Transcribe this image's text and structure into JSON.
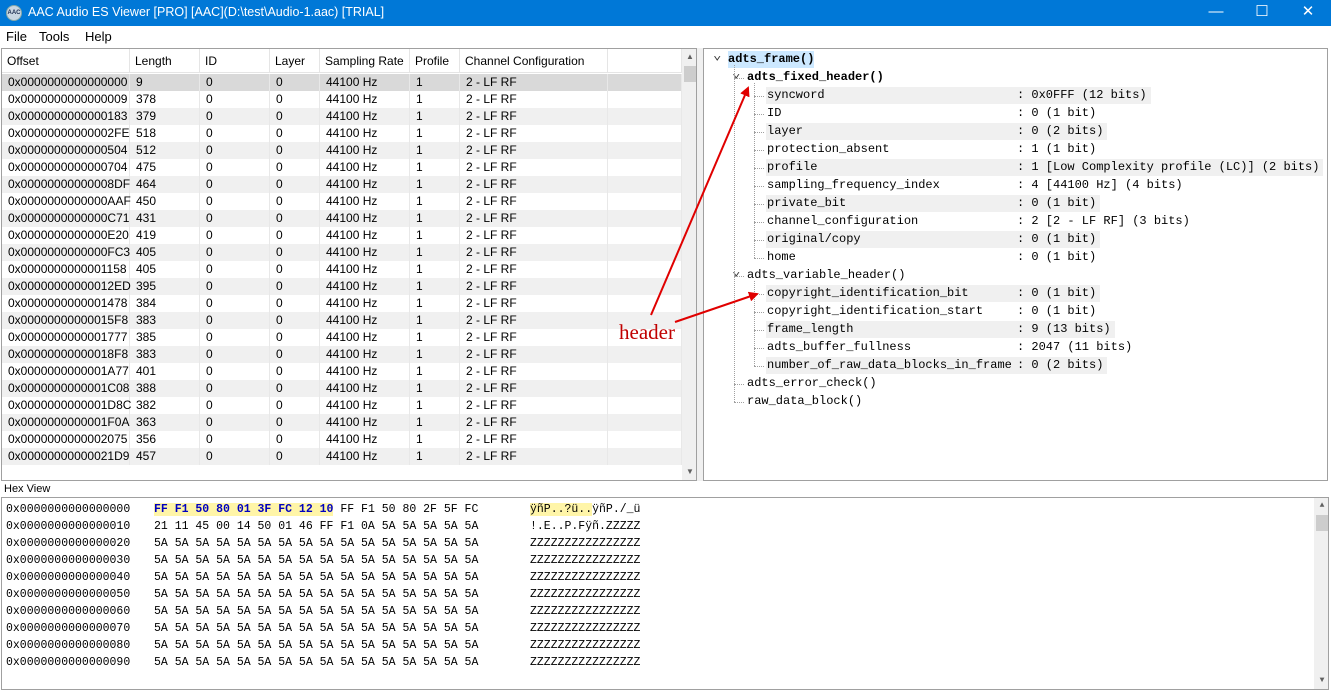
{
  "window": {
    "title": "AAC Audio ES Viewer [PRO] [AAC](D:\\test\\Audio-1.aac) [TRIAL]",
    "icon_text": "AAC",
    "minimize_glyph": "—",
    "maximize_glyph": "☐",
    "close_glyph": "✕"
  },
  "menu": {
    "file": "File",
    "tools": "Tools",
    "help": "Help"
  },
  "frame_list": {
    "columns": [
      "Offset",
      "Length",
      "ID",
      "Layer",
      "Sampling Rate",
      "Profile",
      "Channel Configuration"
    ],
    "rows": [
      [
        "0x0000000000000000",
        "9",
        "0",
        "0",
        "44100 Hz",
        "1",
        "2 - LF RF"
      ],
      [
        "0x0000000000000009",
        "378",
        "0",
        "0",
        "44100 Hz",
        "1",
        "2 - LF RF"
      ],
      [
        "0x0000000000000183",
        "379",
        "0",
        "0",
        "44100 Hz",
        "1",
        "2 - LF RF"
      ],
      [
        "0x00000000000002FE",
        "518",
        "0",
        "0",
        "44100 Hz",
        "1",
        "2 - LF RF"
      ],
      [
        "0x0000000000000504",
        "512",
        "0",
        "0",
        "44100 Hz",
        "1",
        "2 - LF RF"
      ],
      [
        "0x0000000000000704",
        "475",
        "0",
        "0",
        "44100 Hz",
        "1",
        "2 - LF RF"
      ],
      [
        "0x00000000000008DF",
        "464",
        "0",
        "0",
        "44100 Hz",
        "1",
        "2 - LF RF"
      ],
      [
        "0x0000000000000AAF",
        "450",
        "0",
        "0",
        "44100 Hz",
        "1",
        "2 - LF RF"
      ],
      [
        "0x0000000000000C71",
        "431",
        "0",
        "0",
        "44100 Hz",
        "1",
        "2 - LF RF"
      ],
      [
        "0x0000000000000E20",
        "419",
        "0",
        "0",
        "44100 Hz",
        "1",
        "2 - LF RF"
      ],
      [
        "0x0000000000000FC3",
        "405",
        "0",
        "0",
        "44100 Hz",
        "1",
        "2 - LF RF"
      ],
      [
        "0x0000000000001158",
        "405",
        "0",
        "0",
        "44100 Hz",
        "1",
        "2 - LF RF"
      ],
      [
        "0x00000000000012ED",
        "395",
        "0",
        "0",
        "44100 Hz",
        "1",
        "2 - LF RF"
      ],
      [
        "0x0000000000001478",
        "384",
        "0",
        "0",
        "44100 Hz",
        "1",
        "2 - LF RF"
      ],
      [
        "0x00000000000015F8",
        "383",
        "0",
        "0",
        "44100 Hz",
        "1",
        "2 - LF RF"
      ],
      [
        "0x0000000000001777",
        "385",
        "0",
        "0",
        "44100 Hz",
        "1",
        "2 - LF RF"
      ],
      [
        "0x00000000000018F8",
        "383",
        "0",
        "0",
        "44100 Hz",
        "1",
        "2 - LF RF"
      ],
      [
        "0x0000000000001A77",
        "401",
        "0",
        "0",
        "44100 Hz",
        "1",
        "2 - LF RF"
      ],
      [
        "0x0000000000001C08",
        "388",
        "0",
        "0",
        "44100 Hz",
        "1",
        "2 - LF RF"
      ],
      [
        "0x0000000000001D8C",
        "382",
        "0",
        "0",
        "44100 Hz",
        "1",
        "2 - LF RF"
      ],
      [
        "0x0000000000001F0A",
        "363",
        "0",
        "0",
        "44100 Hz",
        "1",
        "2 - LF RF"
      ],
      [
        "0x0000000000002075",
        "356",
        "0",
        "0",
        "44100 Hz",
        "1",
        "2 - LF RF"
      ],
      [
        "0x00000000000021D9",
        "457",
        "0",
        "0",
        "44100 Hz",
        "1",
        "2 - LF RF"
      ]
    ]
  },
  "tree": {
    "root": "adts_frame()",
    "fixed_header": "adts_fixed_header()",
    "fixed_fields": [
      [
        "syncword",
        ": 0x0FFF (12 bits)"
      ],
      [
        "ID",
        ": 0 (1 bit)"
      ],
      [
        "layer",
        ": 0 (2 bits)"
      ],
      [
        "protection_absent",
        ": 1 (1 bit)"
      ],
      [
        "profile",
        ": 1 [Low Complexity profile (LC)] (2 bits)"
      ],
      [
        "sampling_frequency_index",
        ": 4 [44100 Hz] (4 bits)"
      ],
      [
        "private_bit",
        ": 0 (1 bit)"
      ],
      [
        "channel_configuration",
        ": 2 [2 - LF RF] (3 bits)"
      ],
      [
        "original/copy",
        ": 0 (1 bit)"
      ],
      [
        "home",
        ": 0 (1 bit)"
      ]
    ],
    "variable_header": "adts_variable_header()",
    "variable_fields": [
      [
        "copyright_identification_bit",
        ": 0 (1 bit)"
      ],
      [
        "copyright_identification_start",
        ": 0 (1 bit)"
      ],
      [
        "frame_length",
        ": 9 (13 bits)"
      ],
      [
        "adts_buffer_fullness",
        ": 2047 (11 bits)"
      ],
      [
        "number_of_raw_data_blocks_in_frame",
        ": 0 (2 bits)"
      ]
    ],
    "error_check": "adts_error_check()",
    "raw_data": "raw_data_block()"
  },
  "annotation": {
    "label": "header",
    "color": "#e00000"
  },
  "hex_view": {
    "label": "Hex View",
    "rows": [
      {
        "offset": "0x0000000000000000",
        "hl_bytes": "FF F1 50 80 01 3F FC 12 10",
        "bytes": " FF F1 50 80 2F 5F FC",
        "hl_ascii": "ÿñP..?ü..",
        "ascii": "ÿñP./_ü"
      },
      {
        "offset": "0x0000000000000010",
        "hl_bytes": "",
        "bytes": "21 11 45 00 14 50 01 46 FF F1 0A 5A 5A 5A 5A 5A",
        "hl_ascii": "",
        "ascii": "!.E..P.Fÿñ.ZZZZZ"
      },
      {
        "offset": "0x0000000000000020",
        "hl_bytes": "",
        "bytes": "5A 5A 5A 5A 5A 5A 5A 5A 5A 5A 5A 5A 5A 5A 5A 5A",
        "hl_ascii": "",
        "ascii": "ZZZZZZZZZZZZZZZZ"
      },
      {
        "offset": "0x0000000000000030",
        "hl_bytes": "",
        "bytes": "5A 5A 5A 5A 5A 5A 5A 5A 5A 5A 5A 5A 5A 5A 5A 5A",
        "hl_ascii": "",
        "ascii": "ZZZZZZZZZZZZZZZZ"
      },
      {
        "offset": "0x0000000000000040",
        "hl_bytes": "",
        "bytes": "5A 5A 5A 5A 5A 5A 5A 5A 5A 5A 5A 5A 5A 5A 5A 5A",
        "hl_ascii": "",
        "ascii": "ZZZZZZZZZZZZZZZZ"
      },
      {
        "offset": "0x0000000000000050",
        "hl_bytes": "",
        "bytes": "5A 5A 5A 5A 5A 5A 5A 5A 5A 5A 5A 5A 5A 5A 5A 5A",
        "hl_ascii": "",
        "ascii": "ZZZZZZZZZZZZZZZZ"
      },
      {
        "offset": "0x0000000000000060",
        "hl_bytes": "",
        "bytes": "5A 5A 5A 5A 5A 5A 5A 5A 5A 5A 5A 5A 5A 5A 5A 5A",
        "hl_ascii": "",
        "ascii": "ZZZZZZZZZZZZZZZZ"
      },
      {
        "offset": "0x0000000000000070",
        "hl_bytes": "",
        "bytes": "5A 5A 5A 5A 5A 5A 5A 5A 5A 5A 5A 5A 5A 5A 5A 5A",
        "hl_ascii": "",
        "ascii": "ZZZZZZZZZZZZZZZZ"
      },
      {
        "offset": "0x0000000000000080",
        "hl_bytes": "",
        "bytes": "5A 5A 5A 5A 5A 5A 5A 5A 5A 5A 5A 5A 5A 5A 5A 5A",
        "hl_ascii": "",
        "ascii": "ZZZZZZZZZZZZZZZZ"
      },
      {
        "offset": "0x0000000000000090",
        "hl_bytes": "",
        "bytes": "5A 5A 5A 5A 5A 5A 5A 5A 5A 5A 5A 5A 5A 5A 5A 5A",
        "hl_ascii": "",
        "ascii": "ZZZZZZZZZZZZZZZZ"
      }
    ]
  },
  "colors": {
    "titlebar": "#0078d7",
    "highlight_bg": "#fff5a8",
    "highlight_fg": "#0000c0",
    "row_selected": "#d9d9d9"
  }
}
